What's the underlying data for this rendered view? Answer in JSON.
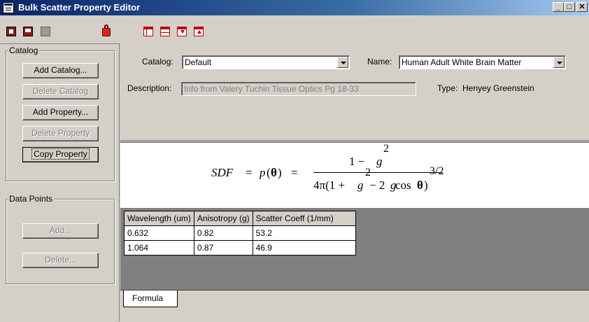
{
  "window": {
    "title": "Bulk Scatter Property Editor",
    "minimize": "_",
    "maximize": "□",
    "close": "✕"
  },
  "toolbar": {
    "icons": [
      "open-catalog-icon",
      "new-catalog-icon",
      "save-icon",
      "lock-icon",
      "window-left-icon",
      "window-split-icon",
      "move-down-icon",
      "move-up-icon"
    ]
  },
  "catalog_group": {
    "label": "Catalog",
    "buttons": [
      {
        "label": "Add Catalog...",
        "enabled": true
      },
      {
        "label": "Delete Catalog",
        "enabled": false
      },
      {
        "label": "Add Property...",
        "enabled": true
      },
      {
        "label": "Delete Property",
        "enabled": false
      },
      {
        "label": "Copy Property",
        "enabled": true,
        "focused": true
      }
    ]
  },
  "data_points_group": {
    "label": "Data Points",
    "buttons": [
      {
        "label": "Add...",
        "enabled": false
      },
      {
        "label": "Delete...",
        "enabled": false
      }
    ]
  },
  "form": {
    "catalog_label": "Catalog:",
    "catalog_value": "Default",
    "name_label": "Name:",
    "name_value": "Human Adult White Brain Matter",
    "description_label": "Description:",
    "description_value": "Info from Valery Tuchin Tissue Optics Pg 18-33",
    "type_label": "Type:",
    "type_value": "Henyey Greenstein"
  },
  "formula": {
    "lhs_sdf": "SDF",
    "eq1": "=",
    "p": "p",
    "theta_open": "(",
    "theta": "θ",
    "theta_close": ")",
    "eq2": "=",
    "num_one_minus": "1 − ",
    "num_g": "g",
    "num_exp": "2",
    "den_prefix": "4π(1 + ",
    "den_g": "g",
    "den_g_exp": "2",
    "den_mid": " − 2",
    "den_g2": "g",
    "den_cos": " cos",
    "den_theta": "θ",
    "den_close": ")",
    "den_exp": "3/2"
  },
  "table": {
    "headers": [
      "Wavelength (um)",
      "Anisotropy (g)",
      "Scatter Coeff (1/mm)"
    ],
    "rows": [
      [
        "0.632",
        "0.82",
        "53.2"
      ],
      [
        "1.064",
        "0.87",
        "46.9"
      ]
    ]
  },
  "tabs": [
    {
      "label": "Formula",
      "active": true
    }
  ]
}
